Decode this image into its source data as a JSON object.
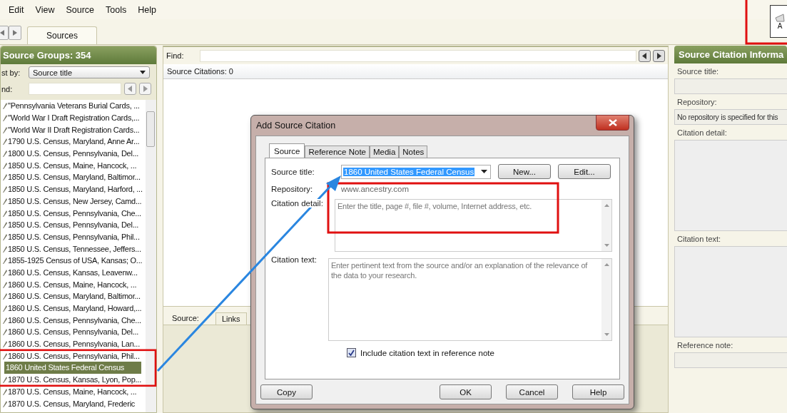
{
  "menu": [
    "Edit",
    "View",
    "Source",
    "Tools",
    "Help"
  ],
  "tabs": [
    {
      "label": "Sources",
      "selected": true
    }
  ],
  "toolbar_button": {
    "label": "A"
  },
  "source_groups": {
    "title": "Source Groups: 354",
    "list_by_label": "st by:",
    "list_by_value": "Source title",
    "find_label": "nd:",
    "items": [
      {
        "label": "\"Pennsylvania Veterans Burial Cards, ...",
        "selected": false
      },
      {
        "label": "\"World War I Draft Registration Cards,...",
        "selected": false
      },
      {
        "label": "\"World War II Draft Registration Cards...",
        "selected": false
      },
      {
        "label": "1790 U.S. Census, Maryland, Anne Ar...",
        "selected": false
      },
      {
        "label": "1800 U.S. Census, Pennsylvania, Del...",
        "selected": false
      },
      {
        "label": "1850 U.S. Census, Maine, Hancock, ...",
        "selected": false
      },
      {
        "label": "1850 U.S. Census, Maryland, Baltimor...",
        "selected": false
      },
      {
        "label": "1850 U.S. Census, Maryland, Harford, ...",
        "selected": false
      },
      {
        "label": "1850 U.S. Census, New Jersey, Camd...",
        "selected": false
      },
      {
        "label": "1850 U.S. Census, Pennsylvania, Che...",
        "selected": false
      },
      {
        "label": "1850 U.S. Census, Pennsylvania, Del...",
        "selected": false
      },
      {
        "label": "1850 U.S. Census, Pennsylvania, Phil...",
        "selected": false
      },
      {
        "label": "1850 U.S. Census, Tennessee, Jeffers...",
        "selected": false
      },
      {
        "label": "1855-1925 Census of USA, Kansas; O...",
        "selected": false
      },
      {
        "label": "1860 U.S. Census, Kansas, Leavenw...",
        "selected": false
      },
      {
        "label": "1860 U.S. Census, Maine, Hancock, ...",
        "selected": false
      },
      {
        "label": "1860 U.S. Census, Maryland, Baltimor...",
        "selected": false
      },
      {
        "label": "1860 U.S. Census, Maryland, Howard,...",
        "selected": false
      },
      {
        "label": "1860 U.S. Census, Pennsylvania, Che...",
        "selected": false
      },
      {
        "label": "1860 U.S. Census, Pennsylvania, Del...",
        "selected": false
      },
      {
        "label": "1860 U.S. Census, Pennsylvania, Lan...",
        "selected": false
      },
      {
        "label": "1860 U.S. Census, Pennsylvania, Phil...",
        "selected": false
      },
      {
        "label": "1860 United States Federal Census",
        "selected": true
      },
      {
        "label": "1870 U.S. Census, Kansas, Lyon, Pop...",
        "selected": false
      },
      {
        "label": "1870 U.S. Census, Maine, Hancock, ...",
        "selected": false
      },
      {
        "label": "1870 U.S. Census, Maryland, Frederic",
        "selected": false
      }
    ]
  },
  "citations": {
    "find_label": "Find:",
    "count": "Source Citations: 0",
    "bottom_tabs": [
      {
        "label": "Source:",
        "selected": true
      },
      {
        "label": "Links",
        "selected": false
      }
    ]
  },
  "citation_info": {
    "title": "Source Citation Informa",
    "fields": [
      {
        "label": "Source title:",
        "kind": "line"
      },
      {
        "label": "Repository:",
        "kind": "line",
        "value": "No repository is specified for this"
      },
      {
        "label": "Citation detail:",
        "kind": "area"
      },
      {
        "label": "Citation text:",
        "kind": "area"
      },
      {
        "label": "Reference note:",
        "kind": "line"
      }
    ]
  },
  "dialog": {
    "title": "Add Source Citation",
    "tabs": [
      {
        "label": "Source",
        "selected": true
      },
      {
        "label": "Reference Note",
        "selected": false
      },
      {
        "label": "Media",
        "selected": false
      },
      {
        "label": "Notes",
        "selected": false
      }
    ],
    "source_title_label": "Source title:",
    "source_title_value": "1860 United States Federal Census",
    "new_button": "New...",
    "edit_button": "Edit...",
    "repository_label": "Repository:",
    "repository_value": "www.ancestry.com",
    "citation_detail_label": "Citation detail:",
    "citation_detail_placeholder": "Enter the title, page #, file #, volume, Internet address, etc.",
    "citation_text_label": "Citation text:",
    "citation_text_placeholder": "Enter pertinent text from the source and/or an explanation of the relevance of the data to your research.",
    "include_checkbox": {
      "label": "Include citation text in reference note",
      "checked": true
    },
    "copy_button": "Copy",
    "buttons": [
      "OK",
      "Cancel",
      "Help"
    ]
  }
}
